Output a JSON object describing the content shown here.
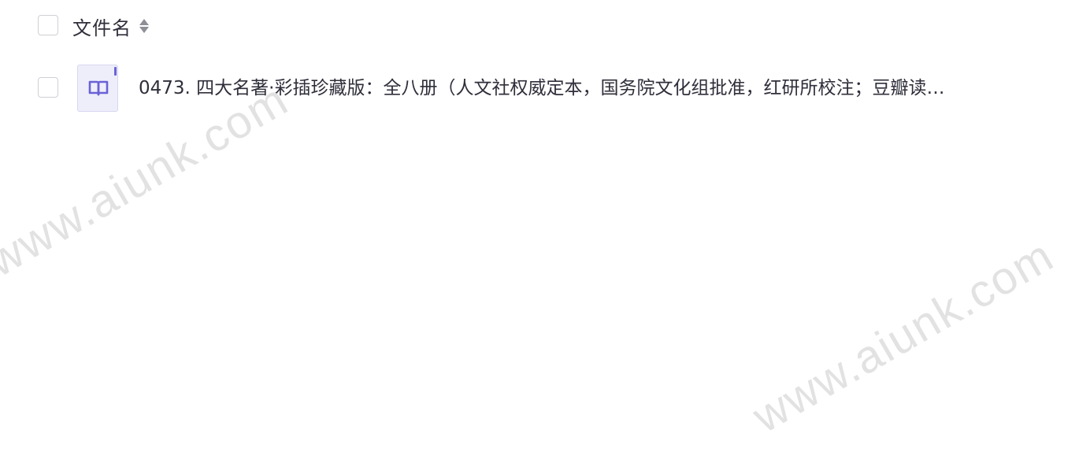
{
  "table": {
    "header": {
      "column_label": "文件名",
      "sort_icon": "sort-both-icon"
    },
    "rows": [
      {
        "icon": "book-file-icon",
        "name": "0473. 四大名著·彩插珍藏版：全八册（人文社权威定本，国务院文化组批准，红研所校注；豆瓣读…"
      }
    ]
  },
  "watermark": {
    "text": "www.aiunk.com"
  },
  "colors": {
    "text": "#2f2f3b",
    "checkbox_border": "#cfd0d6",
    "icon_bg": "#eeeefb",
    "icon_accent": "#6a62d6",
    "watermark": "#e2e2e2"
  }
}
